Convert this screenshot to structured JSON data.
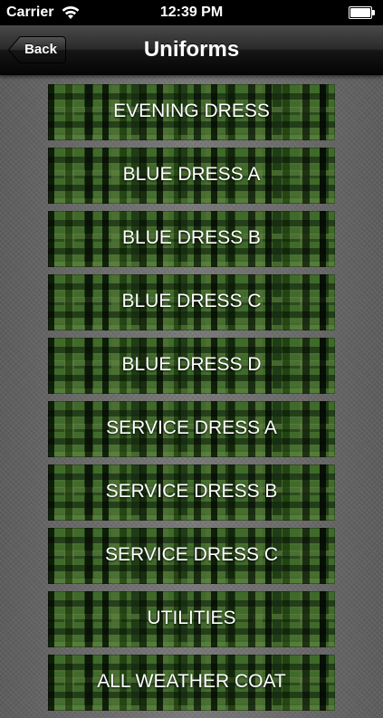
{
  "status_bar": {
    "carrier": "Carrier",
    "time": "12:39 PM",
    "wifi_icon": "wifi-icon",
    "battery_icon": "battery-icon"
  },
  "nav": {
    "back_label": "Back",
    "title": "Uniforms"
  },
  "uniforms": [
    {
      "label": "EVENING DRESS"
    },
    {
      "label": "BLUE DRESS A"
    },
    {
      "label": "BLUE DRESS B"
    },
    {
      "label": "BLUE DRESS C"
    },
    {
      "label": "BLUE DRESS D"
    },
    {
      "label": "SERVICE DRESS A"
    },
    {
      "label": "SERVICE DRESS B"
    },
    {
      "label": "SERVICE DRESS C"
    },
    {
      "label": "UTILITIES"
    },
    {
      "label": "ALL WEATHER COAT"
    }
  ],
  "colors": {
    "status_bar": "#000000",
    "nav_bar": "#1a1a1a",
    "camo_base": "#3f6a2a",
    "background": "#6e6e6e",
    "text": "#ffffff"
  }
}
